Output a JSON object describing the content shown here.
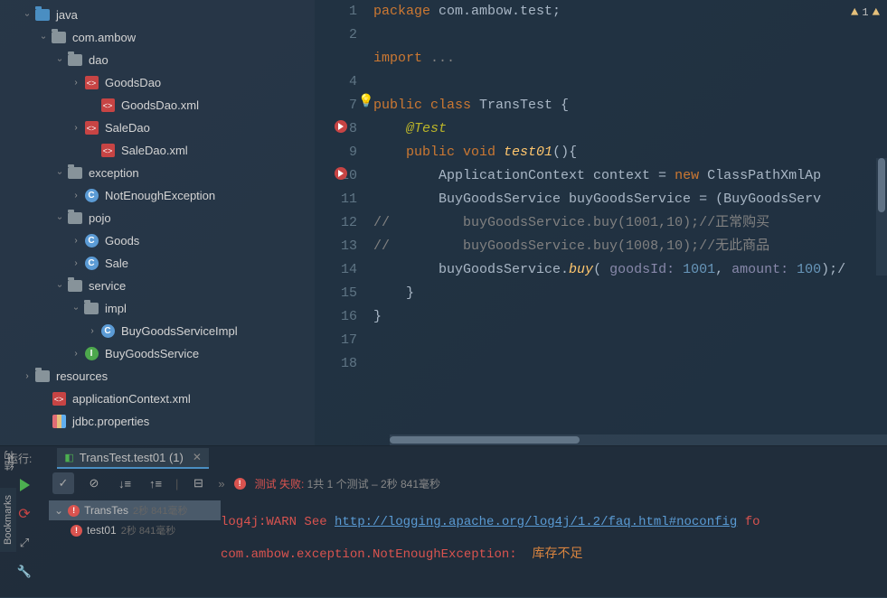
{
  "sidebar": {
    "tree": [
      {
        "depth": 1,
        "arrow": "expanded",
        "iconType": "folder-blue",
        "label": "java"
      },
      {
        "depth": 2,
        "arrow": "expanded",
        "iconType": "folder",
        "label": "com.ambow"
      },
      {
        "depth": 3,
        "arrow": "expanded",
        "iconType": "folder",
        "label": "dao"
      },
      {
        "depth": 4,
        "arrow": "collapsed",
        "iconType": "xml",
        "label": "GoodsDao"
      },
      {
        "depth": 5,
        "arrow": "none",
        "iconType": "xml",
        "label": "GoodsDao.xml"
      },
      {
        "depth": 4,
        "arrow": "collapsed",
        "iconType": "xml",
        "label": "SaleDao"
      },
      {
        "depth": 5,
        "arrow": "none",
        "iconType": "xml",
        "label": "SaleDao.xml"
      },
      {
        "depth": 3,
        "arrow": "expanded",
        "iconType": "folder",
        "label": "exception"
      },
      {
        "depth": 4,
        "arrow": "collapsed",
        "iconType": "class",
        "label": "NotEnoughException"
      },
      {
        "depth": 3,
        "arrow": "expanded",
        "iconType": "folder",
        "label": "pojo"
      },
      {
        "depth": 4,
        "arrow": "collapsed",
        "iconType": "class",
        "label": "Goods"
      },
      {
        "depth": 4,
        "arrow": "collapsed",
        "iconType": "class",
        "label": "Sale"
      },
      {
        "depth": 3,
        "arrow": "expanded",
        "iconType": "folder",
        "label": "service"
      },
      {
        "depth": 4,
        "arrow": "expanded",
        "iconType": "folder",
        "label": "impl"
      },
      {
        "depth": 5,
        "arrow": "collapsed",
        "iconType": "class",
        "label": "BuyGoodsServiceImpl"
      },
      {
        "depth": 4,
        "arrow": "collapsed",
        "iconType": "interface",
        "label": "BuyGoodsService"
      },
      {
        "depth": 1,
        "arrow": "collapsed",
        "iconType": "folder",
        "label": "resources"
      },
      {
        "depth": 2,
        "arrow": "none",
        "iconType": "xml",
        "label": "applicationContext.xml"
      },
      {
        "depth": 2,
        "arrow": "none",
        "iconType": "props",
        "label": "jdbc.properties"
      }
    ]
  },
  "editor": {
    "warn_count": "1",
    "lines": {
      "l1_kw": "package",
      "l1_rest": " com.ambow.test;",
      "l4_kw": "import",
      "l4_rest": " ...",
      "l8_kw1": "public ",
      "l8_kw2": "class ",
      "l8_cls": "TransTest ",
      "l8_brace": "{",
      "l9_anno": "@Test",
      "l10_kw1": "public ",
      "l10_kw2": "void ",
      "l10_meth": "test01",
      "l10_rest": "(){",
      "l11": "ApplicationContext context = ",
      "l11_kw": "new ",
      "l11_cls": "ClassPathXmlAp",
      "l12": "BuyGoodsService buyGoodsService = (BuyGoodsServ",
      "l13_c1": "//",
      "l13_code": "         buyGoodsService.buy(1001,10);",
      "l13_c2": "//正常购买",
      "l14_c1": "//",
      "l14_code": "         buyGoodsService.buy(1008,10);",
      "l14_c2": "//无此商品",
      "l15_obj": "buyGoodsService.",
      "l15_meth": "buy",
      "l15_paren": "( ",
      "l15_p1": "goodsId: ",
      "l15_n1": "1001",
      "l15_comma": ", ",
      "l15_p2": "amount: ",
      "l15_n2": "100",
      "l15_end": ");/",
      "l16": "}",
      "l17": "}"
    },
    "gutter": [
      "1",
      "2",
      "",
      "4",
      "7",
      "8",
      "9",
      "10",
      "11",
      "12",
      "13",
      "14",
      "15",
      "16",
      "17",
      "18"
    ]
  },
  "run": {
    "label": "运行:",
    "tab": "TransTest.test01 (1)",
    "status_fail": "测试 失败:",
    "status_rest": " 1共 1 个测试 – 2秒 841毫秒",
    "tree": [
      {
        "name": "TransTes",
        "time": "2秒 841毫秒",
        "sel": true,
        "arrow": true
      },
      {
        "name": "test01",
        "time": "2秒 841毫秒",
        "sel": false,
        "arrow": false
      }
    ],
    "console": {
      "l1_pre": "log4j:WARN See ",
      "l1_link": "http://logging.apache.org/log4j/1.2/faq.html#noconfig",
      "l1_post": " fo",
      "l2_exc": "com.ambow.exception.NotEnoughException: ",
      "l2_msg": " 库存不足"
    }
  },
  "bookmarks_label": "Bookmarks",
  "struct_label": "结构"
}
